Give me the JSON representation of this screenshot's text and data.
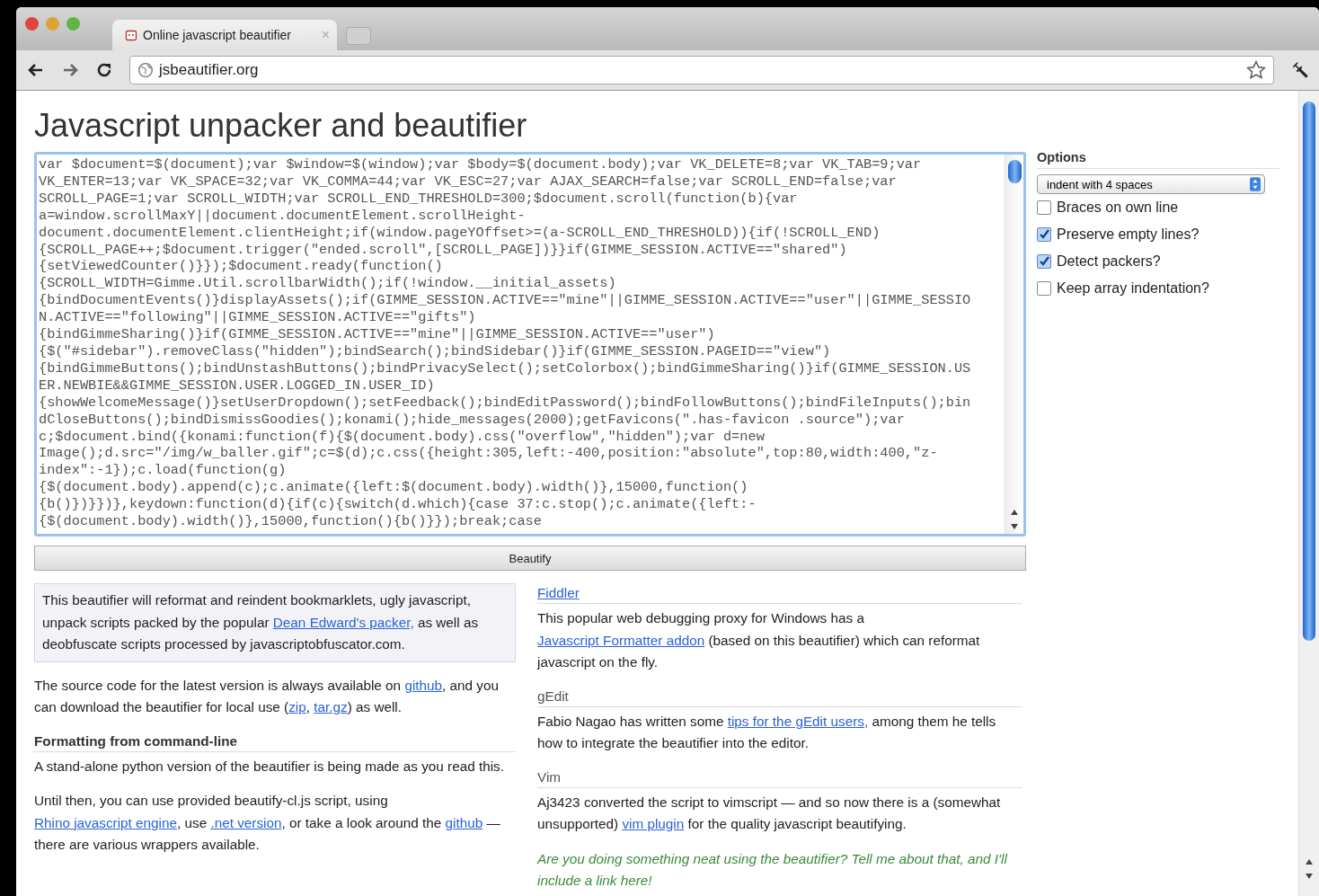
{
  "browser": {
    "tab": {
      "title": "Online javascript beautifier",
      "close": "×"
    },
    "address": "jsbeautifier.org"
  },
  "page": {
    "title": "Javascript unpacker and beautifier",
    "code_lines": [
      "var $document=$(document);var $window=$(window);var $body=$(document.body);var VK_DELETE=8;var VK_TAB=9;var",
      "VK_ENTER=13;var VK_SPACE=32;var VK_COMMA=44;var VK_ESC=27;var AJAX_SEARCH=false;var SCROLL_END=false;var",
      "SCROLL_PAGE=1;var SCROLL_WIDTH;var SCROLL_END_THRESHOLD=300;$document.scroll(function(b){var",
      "a=window.scrollMaxY||document.documentElement.scrollHeight-",
      "document.documentElement.clientHeight;if(window.pageYOffset>=(a-SCROLL_END_THRESHOLD)){if(!SCROLL_END)",
      "{SCROLL_PAGE++;$document.trigger(\"ended.scroll\",[SCROLL_PAGE])}}if(GIMME_SESSION.ACTIVE==\"shared\")",
      "{setViewedCounter()}});$document.ready(function()",
      "{SCROLL_WIDTH=Gimme.Util.scrollbarWidth();if(!window.__initial_assets)",
      "{bindDocumentEvents()}displayAssets();if(GIMME_SESSION.ACTIVE==\"mine\"||GIMME_SESSION.ACTIVE==\"user\"||GIMME_SESSIO",
      "N.ACTIVE==\"following\"||GIMME_SESSION.ACTIVE==\"gifts\")",
      "{bindGimmeSharing()}if(GIMME_SESSION.ACTIVE==\"mine\"||GIMME_SESSION.ACTIVE==\"user\")",
      "{$(\"#sidebar\").removeClass(\"hidden\");bindSearch();bindSidebar()}if(GIMME_SESSION.PAGEID==\"view\")",
      "{bindGimmeButtons();bindUnstashButtons();bindPrivacySelect();setColorbox();bindGimmeSharing()}if(GIMME_SESSION.US",
      "ER.NEWBIE&&GIMME_SESSION.USER.LOGGED_IN.USER_ID)",
      "{showWelcomeMessage()}setUserDropdown();setFeedback();bindEditPassword();bindFollowButtons();bindFileInputs();bin",
      "dCloseButtons();bindDismissGoodies();konami();hide_messages(2000);getFavicons(\".has-favicon .source\");var",
      "c;$document.bind({konami:function(f){$(document.body).css(\"overflow\",\"hidden\");var d=new",
      "Image();d.src=\"/img/w_baller.gif\";c=$(d);c.css({height:305,left:-400,position:\"absolute\",top:80,width:400,\"z-",
      "index\":-1});c.load(function(g)",
      "{$(document.body).append(c);c.animate({left:$(document.body).width()},15000,function()",
      "{b()})}})},keydown:function(d){if(c){switch(d.which){case 37:c.stop();c.animate({left:-",
      "{$(document.body).width()},15000,function(){b()}});break;case"
    ],
    "options": {
      "heading": "Options",
      "indent_select": "indent with 4 spaces",
      "checkboxes": [
        {
          "label": "Braces on own line",
          "checked": false
        },
        {
          "label": "Preserve empty lines?",
          "checked": true
        },
        {
          "label": "Detect packers?",
          "checked": true
        },
        {
          "label": "Keep array indentation?",
          "checked": false
        }
      ]
    },
    "beautify_button": "Beautify",
    "left_column": [
      {
        "kind": "intro",
        "segments": [
          {
            "text": "This beautifier will reformat and reindent bookmarklets, ugly javascript, unpack scripts packed by the popular ",
            "link": false
          },
          {
            "text": "Dean Edward's packer,",
            "link": true
          },
          {
            "text": " as well as deobfuscate scripts processed by javascriptobfuscator.com.",
            "link": false
          }
        ]
      },
      {
        "kind": "paragraph",
        "segments": [
          {
            "text": "The source code for the latest version is always available on ",
            "link": false
          },
          {
            "text": "github",
            "link": true
          },
          {
            "text": ", and you can download the beautifier for local use (",
            "link": false
          },
          {
            "text": "zip",
            "link": true
          },
          {
            "text": ", ",
            "link": false
          },
          {
            "text": "tar.gz",
            "link": true
          },
          {
            "text": ") as well.",
            "link": false
          }
        ]
      },
      {
        "kind": "heading",
        "segments": [
          {
            "text": "Formatting from command-line",
            "link": false
          }
        ]
      },
      {
        "kind": "paragraph",
        "segments": [
          {
            "text": "A stand-alone python version of the beautifier is being made as you read this.",
            "link": false
          }
        ]
      },
      {
        "kind": "paragraph",
        "segments": [
          {
            "text": "Until then, you can use provided beautify-cl.js script, using ",
            "link": false
          },
          {
            "text": "Rhino javascript engine",
            "link": true
          },
          {
            "text": ", use ",
            "link": false
          },
          {
            "text": ".net version",
            "link": true
          },
          {
            "text": ", or take a look around the ",
            "link": false
          },
          {
            "text": "github",
            "link": true
          },
          {
            "text": " — there are various wrappers available.",
            "link": false
          }
        ]
      }
    ],
    "right_column": [
      {
        "kind": "heading",
        "segments": [
          {
            "text": "Fiddler",
            "link": true
          }
        ]
      },
      {
        "kind": "paragraph",
        "segments": [
          {
            "text": "This popular web debugging proxy for Windows has a ",
            "link": false
          },
          {
            "text": "Javascript Formatter addon",
            "link": true
          },
          {
            "text": " (based on this beautifier) which can reformat javascript on the fly.",
            "link": false
          }
        ]
      },
      {
        "kind": "heading",
        "segments": [
          {
            "text": "gEdit",
            "link": false
          }
        ]
      },
      {
        "kind": "paragraph",
        "segments": [
          {
            "text": "Fabio Nagao has written some ",
            "link": false
          },
          {
            "text": "tips for the gEdit users,",
            "link": true
          },
          {
            "text": " among them he tells how to integrate the beautifier into the editor.",
            "link": false
          }
        ]
      },
      {
        "kind": "heading",
        "segments": [
          {
            "text": "Vim",
            "link": false
          }
        ]
      },
      {
        "kind": "paragraph",
        "segments": [
          {
            "text": "Aj3423 converted the script to vimscript — and so now there is a (somewhat unsupported) ",
            "link": false
          },
          {
            "text": "vim plugin",
            "link": true
          },
          {
            "text": " for the quality javascript beautifying.",
            "link": false
          }
        ]
      },
      {
        "kind": "note",
        "segments": [
          {
            "text": "Are you doing something neat using the beautifier? Tell me about that, and I'll include a link here!",
            "link": false
          }
        ]
      }
    ]
  }
}
